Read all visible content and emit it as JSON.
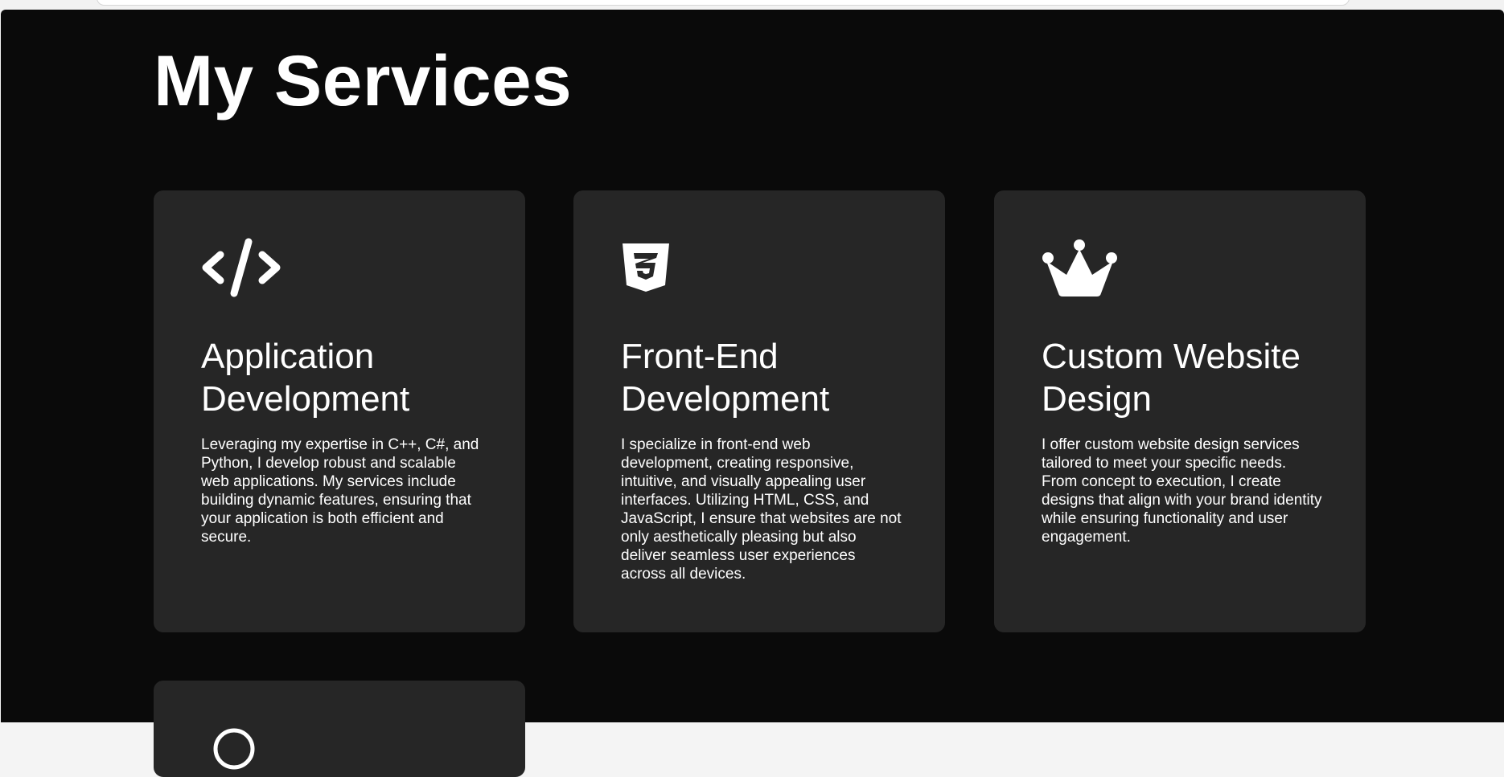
{
  "page": {
    "title": "My Services"
  },
  "services": [
    {
      "icon": "code-icon",
      "title": "Application Development",
      "text": "Leveraging my expertise in C++, C#, and Python, I develop robust and scalable web applications. My services include building dynamic features, ensuring that your application is both efficient and secure."
    },
    {
      "icon": "css3-icon",
      "title": "Front-End Development",
      "text": "I specialize in front-end web development, creating responsive, intuitive, and visually appealing user interfaces. Utilizing HTML, CSS, and JavaScript, I ensure that websites are not only aesthetically pleasing but also deliver seamless user experiences across all devices."
    },
    {
      "icon": "crown-icon",
      "title": "Custom Website Design",
      "text": "I offer custom website design services tailored to meet your specific needs. From concept to execution, I create designs that align with your brand identity while ensuring functionality and user engagement."
    },
    {
      "icon": "circle-icon"
    }
  ],
  "colors": {
    "background": "#0a0a0a",
    "card": "#262626",
    "text": "#ffffff"
  }
}
